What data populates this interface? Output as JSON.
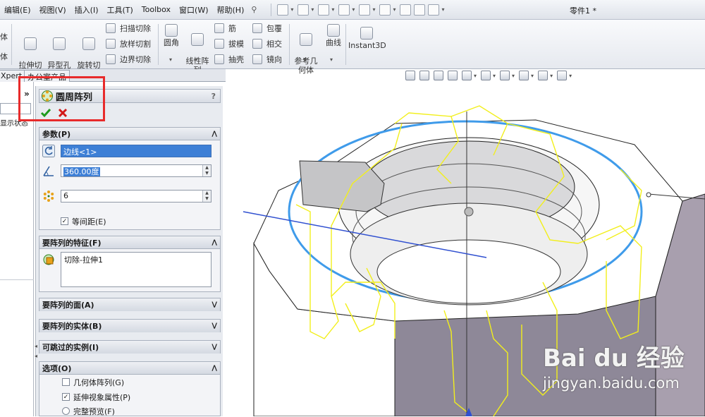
{
  "menu": [
    "编辑(E)",
    "视图(V)",
    "插入(I)",
    "工具(T)",
    "Toolbox",
    "窗口(W)",
    "帮助(H)"
  ],
  "window": {
    "doc_title": "零件1 *"
  },
  "toolbar": {
    "left_cut_labels": [
      "体",
      "体"
    ],
    "extrude_cut": "拉伸切\n除",
    "hole_wizard": "异型孔\n向导",
    "revolve_cut": "旋转切\n除",
    "sweep_cut": "扫描切除",
    "loft_cut": "放样切割",
    "boundary_cut": "边界切除",
    "fillet": "圆角",
    "linear_pattern": "线性阵\n列",
    "rib": "筋",
    "draft": "拔模",
    "shell": "抽壳",
    "wrap": "包覆",
    "intersect": "相交",
    "mirror": "镜向",
    "ref_geometry": "参考几\n何体",
    "curves": "曲线",
    "instant3d": "Instant3D"
  },
  "tabs": {
    "xpert": "Xpert",
    "office": "办公室产品"
  },
  "tree": {
    "show_state": "显示状态"
  },
  "property_manager": {
    "title": "圆周阵列",
    "help": "?",
    "ok_icon": "checkmark-icon",
    "cancel_icon": "x-icon",
    "parameters": {
      "header": "参数(P)",
      "axis_value": "边线<1>",
      "angle_value": "360.00度",
      "instances_value": "6",
      "equal_spacing_label": "等间距(E)",
      "equal_spacing_checked": true
    },
    "features": {
      "header": "要阵列的特征(F)",
      "items": [
        "切除-拉伸1"
      ]
    },
    "faces": {
      "header": "要阵列的面(A)"
    },
    "bodies": {
      "header": "要阵列的实体(B)"
    },
    "skip": {
      "header": "可跳过的实例(I)"
    },
    "options": {
      "header": "选项(O)",
      "geometry_pattern": "几何体阵列(G)",
      "geometry_pattern_checked": false,
      "propagate": "延伸视象属性(P)",
      "propagate_checked": true,
      "full_preview": "完整预览(F)"
    }
  },
  "watermark": {
    "logo": "Bai du 经验",
    "url": "jingyan.baidu.com"
  },
  "colors": {
    "highlight": "#e82b2b",
    "selection": "#3d7fd6",
    "edge_blue": "#3f9bea",
    "preview_yellow": "#f2ef1c"
  }
}
